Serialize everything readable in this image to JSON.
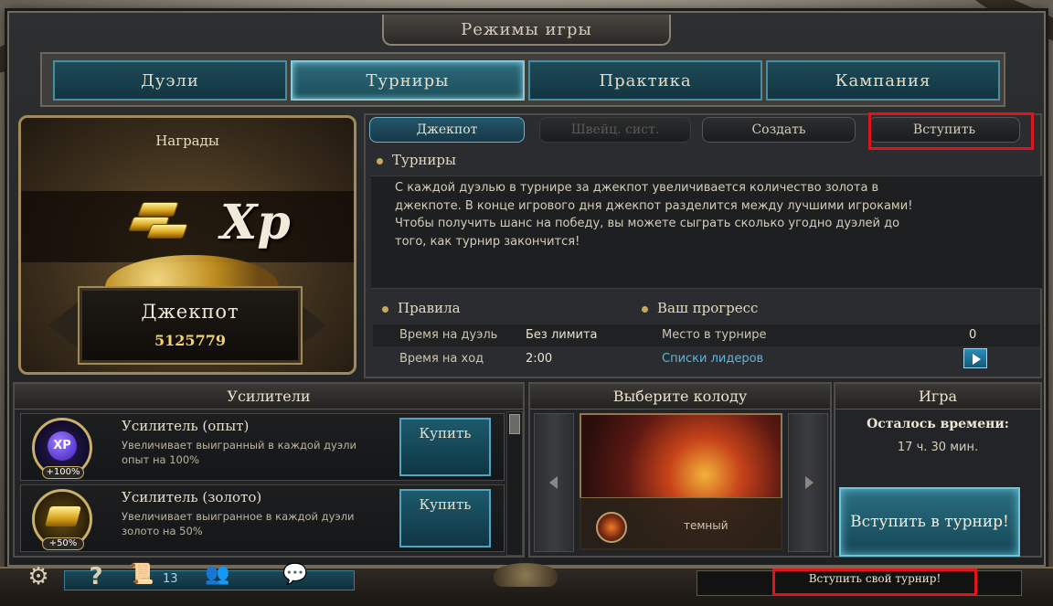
{
  "title": "Режимы игры",
  "mode_tabs": [
    {
      "label": "Дуэли",
      "active": false
    },
    {
      "label": "Турниры",
      "active": true
    },
    {
      "label": "Практика",
      "active": false
    },
    {
      "label": "Кампания",
      "active": false
    }
  ],
  "rewards": {
    "title": "Награды",
    "xp_text": "Xp",
    "jackpot_label": "Джекпот",
    "jackpot_value": "5125779"
  },
  "sub_tabs": [
    {
      "label": "Джекпот",
      "state": "active"
    },
    {
      "label": "Швейц. сист.",
      "state": "disabled"
    },
    {
      "label": "Создать",
      "state": "normal"
    },
    {
      "label": "Вступить",
      "state": "highlighted"
    }
  ],
  "tournaments": {
    "heading": "Турниры",
    "description": [
      "С каждой дуэлью в турнире за джекпот увеличивается количество золота в",
      "джекпоте. В конце игрового дня джекпот разделится между лучшими игроками!",
      "Чтобы получить шанс на победу, вы можете сыграть сколько угодно дуэлей до",
      "того, как турнир закончится!"
    ]
  },
  "rules": {
    "heading": "Правила",
    "time_per_duel_label": "Время на дуэль",
    "time_per_duel_value": "Без лимита",
    "time_per_turn_label": "Время на ход",
    "time_per_turn_value": "2:00"
  },
  "progress": {
    "heading": "Ваш прогресс",
    "place_label": "Место в турнире",
    "place_value": "0",
    "leaderboard_link": "Списки лидеров"
  },
  "boosters": {
    "title": "Усилители",
    "items": [
      {
        "name": "Усилитель (опыт)",
        "desc": "Увеличивает выигранный в каждой дуэли опыт на 100%",
        "badge": "+100%",
        "icon_text": "XP",
        "buy_label": "Купить"
      },
      {
        "name": "Усилитель (золото)",
        "desc": "Увеличивает выигранное в каждой дуэли золото на 50%",
        "badge": "+50%",
        "icon_text": "",
        "buy_label": "Купить"
      }
    ]
  },
  "deck": {
    "title": "Выберите колоду",
    "name": "темный"
  },
  "game": {
    "title": "Игра",
    "time_left_label": "Осталось времени:",
    "time_left_value": "17 ч. 30 мин.",
    "enter_button": "Вступить в турнир!"
  },
  "bottom_bar": {
    "count": "13",
    "status_text": "Вступить свой турнир!"
  },
  "colors": {
    "accent_teal": "#1d5a6c",
    "highlight_red": "#e0141c",
    "gold": "#f3d26a",
    "link_blue": "#5bb8e0"
  }
}
